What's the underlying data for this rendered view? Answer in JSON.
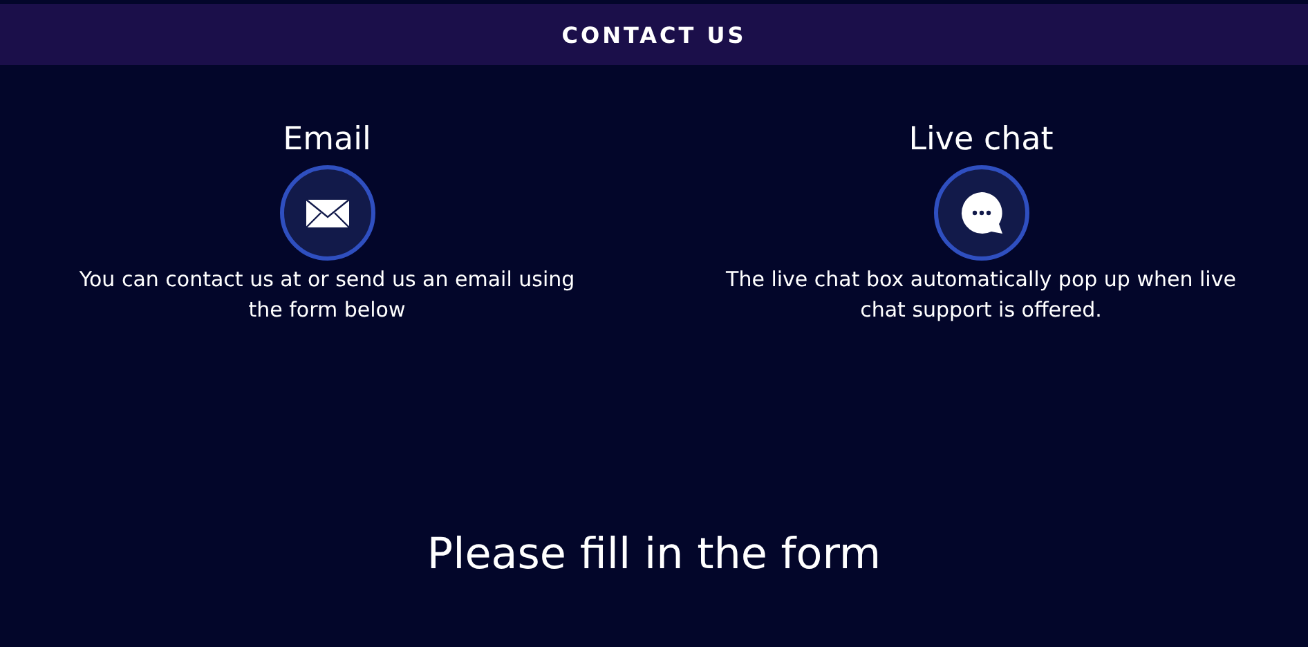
{
  "header": {
    "title": "CONTACT US"
  },
  "channels": [
    {
      "kind": "email",
      "title": "Email",
      "text": "You can contact us at or send us an email using the form below"
    },
    {
      "kind": "chat",
      "title": "Live chat",
      "text": "The live chat box automatically pop up when live chat support is offered."
    }
  ],
  "form": {
    "heading": "Please fill in the form"
  }
}
